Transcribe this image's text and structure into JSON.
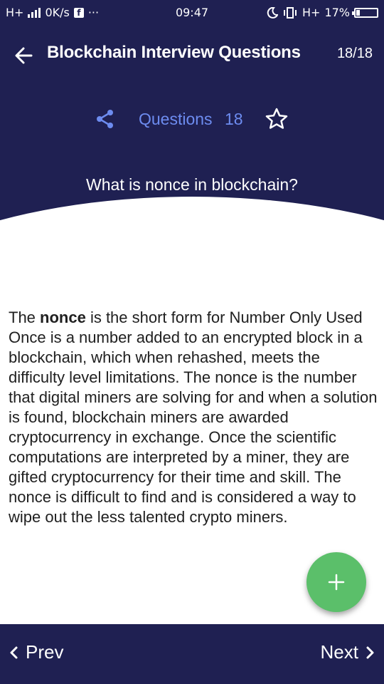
{
  "status_bar": {
    "network": "H+",
    "speed": "0K/s",
    "fb_glyph": "f",
    "dots": "···",
    "time": "09:47",
    "network2": "H+",
    "battery": "17%",
    "battery_level": 0.17
  },
  "header": {
    "title": "Blockchain Interview Questions",
    "counter": "18/18",
    "questions_label": "Questions",
    "questions_count": "18",
    "question_text": "What is nonce in blockchain?"
  },
  "answer": {
    "bold_term": "nonce",
    "prefix": "The ",
    "text": " is the short form for Number Only Used Once is a number added to an encrypted block in a blockchain, which when rehashed, meets the difficulty level limitations. The nonce is the number that digital miners are solving for and when a solution is found, blockchain miners are awarded cryptocurrency in exchange. Once the scientific computations are interpreted by a miner, they are gifted cryptocurrency for their time and skill. The nonce is difficult to find and is considered a way to wipe out the less talented crypto miners."
  },
  "nav": {
    "prev_label": "Prev",
    "next_label": "Next"
  },
  "fab": {
    "symbol": "+"
  },
  "colors": {
    "primary": "#1f2052",
    "accent": "#6d8cf0",
    "fab": "#5bbf6a"
  },
  "icons": [
    "back-arrow-icon",
    "share-icon",
    "star-outline-icon",
    "plus-icon",
    "chevron-left-icon",
    "chevron-right-icon"
  ]
}
